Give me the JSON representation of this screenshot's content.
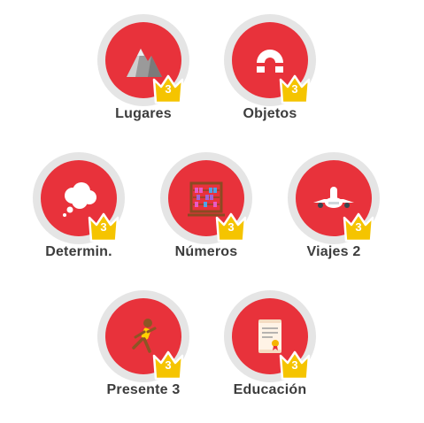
{
  "skills": [
    {
      "label": "Lugares",
      "crown": "3",
      "icon": "mountain-icon"
    },
    {
      "label": "Objetos",
      "crown": "3",
      "icon": "magnet-icon"
    },
    {
      "label": "Determin.",
      "crown": "3",
      "icon": "thought-bubble-icon"
    },
    {
      "label": "Números",
      "crown": "3",
      "icon": "abacus-icon"
    },
    {
      "label": "Viajes 2",
      "crown": "3",
      "icon": "airplane-icon"
    },
    {
      "label": "Presente 3",
      "crown": "3",
      "icon": "runner-icon"
    },
    {
      "label": "Educación",
      "crown": "3",
      "icon": "diploma-icon"
    }
  ],
  "colors": {
    "circle": "#e8323b",
    "ring": "#e5e5e5",
    "crown": "#f5c400",
    "text": "#3c3c3c"
  }
}
